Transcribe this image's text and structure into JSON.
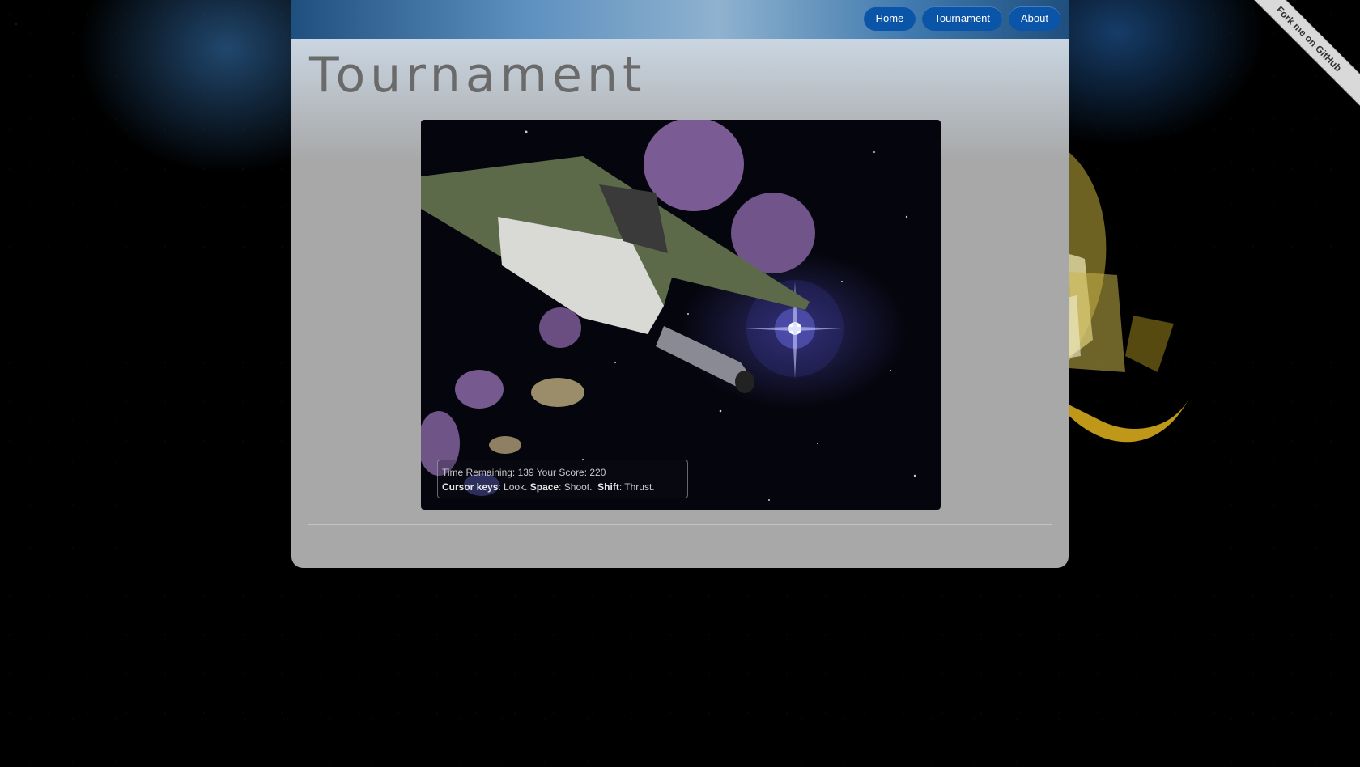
{
  "nav": {
    "items": [
      {
        "label": "Home"
      },
      {
        "label": "Tournament"
      },
      {
        "label": "About"
      }
    ]
  },
  "ribbon": {
    "label": "Fork me on GitHub"
  },
  "page": {
    "title": "Tournament"
  },
  "hud": {
    "time_label": "Time Remaining:",
    "time_value": "139",
    "score_label": "Your Score:",
    "score_value": "220",
    "controls": [
      {
        "key": "Cursor keys",
        "action": "Look."
      },
      {
        "key": "Space",
        "action": "Shoot."
      },
      {
        "key": "Shift",
        "action": "Thrust."
      }
    ]
  },
  "colors": {
    "nav_button": "#0a55a8",
    "panel": "#a8a8a8",
    "title": "#6a6a6a"
  }
}
